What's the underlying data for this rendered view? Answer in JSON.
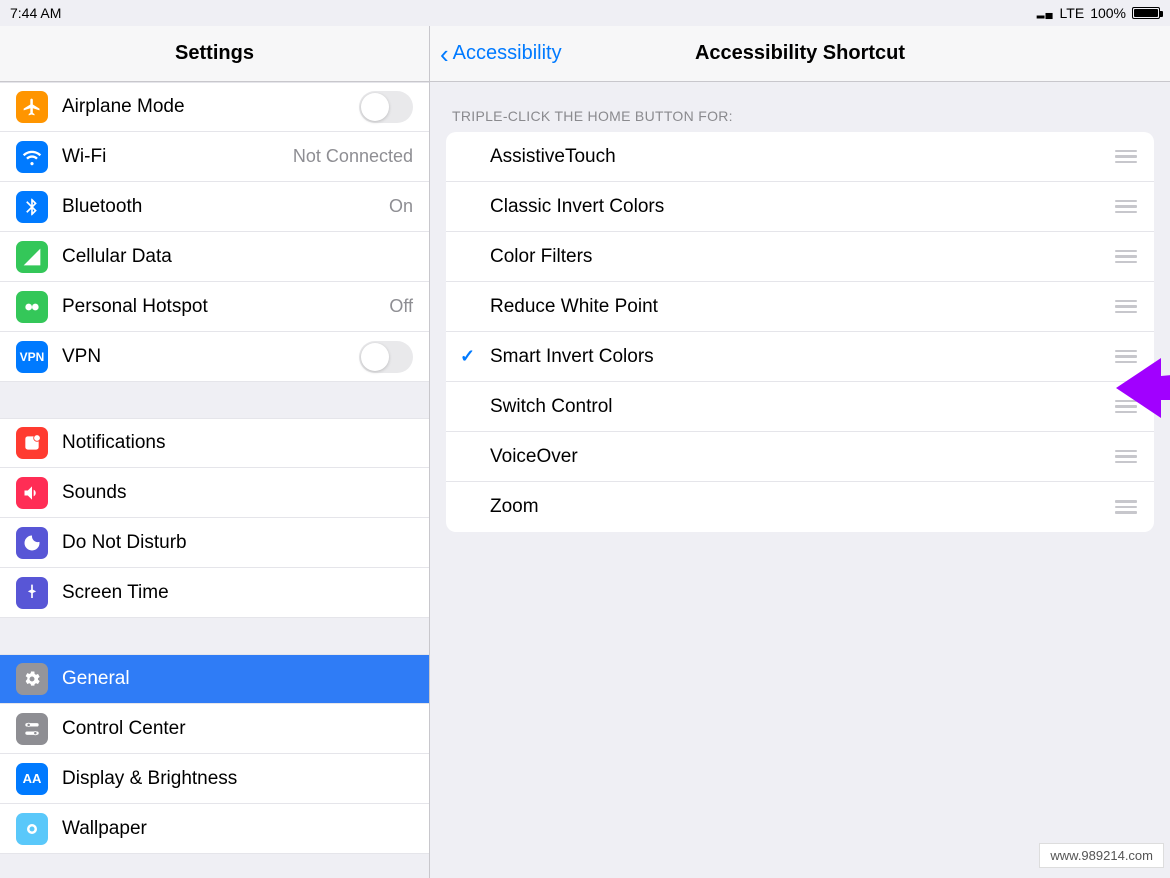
{
  "statusbar": {
    "time": "7:44 AM",
    "carrier": "LTE",
    "battery_pct": "100%"
  },
  "left": {
    "title": "Settings",
    "group1": [
      {
        "icon": "airplane-icon",
        "bg": "bg-orange",
        "label": "Airplane Mode",
        "accessory": "toggle",
        "toggle_on": false
      },
      {
        "icon": "wifi-icon",
        "bg": "bg-blue",
        "label": "Wi-Fi",
        "accessory": "detail",
        "detail": "Not Connected"
      },
      {
        "icon": "bluetooth-icon",
        "bg": "bg-blue",
        "label": "Bluetooth",
        "accessory": "detail",
        "detail": "On"
      },
      {
        "icon": "cellular-icon",
        "bg": "bg-green",
        "label": "Cellular Data",
        "accessory": "none"
      },
      {
        "icon": "hotspot-icon",
        "bg": "bg-green",
        "label": "Personal Hotspot",
        "accessory": "detail",
        "detail": "Off"
      },
      {
        "icon": "vpn-icon",
        "bg": "bg-blue",
        "label": "VPN",
        "accessory": "toggle",
        "toggle_on": false
      }
    ],
    "group2": [
      {
        "icon": "notifications-icon",
        "bg": "bg-red",
        "label": "Notifications"
      },
      {
        "icon": "sounds-icon",
        "bg": "bg-pink",
        "label": "Sounds"
      },
      {
        "icon": "dnd-icon",
        "bg": "bg-purple",
        "label": "Do Not Disturb"
      },
      {
        "icon": "screentime-icon",
        "bg": "bg-purple",
        "label": "Screen Time"
      }
    ],
    "group3": [
      {
        "icon": "general-icon",
        "bg": "bg-gray",
        "label": "General",
        "selected": true
      },
      {
        "icon": "controlcenter-icon",
        "bg": "bg-gray",
        "label": "Control Center"
      },
      {
        "icon": "display-icon",
        "bg": "bg-blue",
        "label": "Display & Brightness"
      },
      {
        "icon": "wallpaper-icon",
        "bg": "bg-lightblue",
        "label": "Wallpaper"
      }
    ]
  },
  "right": {
    "back_label": "Accessibility",
    "title": "Accessibility Shortcut",
    "section_header": "TRIPLE-CLICK THE HOME BUTTON FOR:",
    "options": [
      {
        "label": "AssistiveTouch",
        "checked": false
      },
      {
        "label": "Classic Invert Colors",
        "checked": false
      },
      {
        "label": "Color Filters",
        "checked": false
      },
      {
        "label": "Reduce White Point",
        "checked": false
      },
      {
        "label": "Smart Invert Colors",
        "checked": true
      },
      {
        "label": "Switch Control",
        "checked": false
      },
      {
        "label": "VoiceOver",
        "checked": false
      },
      {
        "label": "Zoom",
        "checked": false
      }
    ]
  },
  "watermark": "www.989214.com"
}
